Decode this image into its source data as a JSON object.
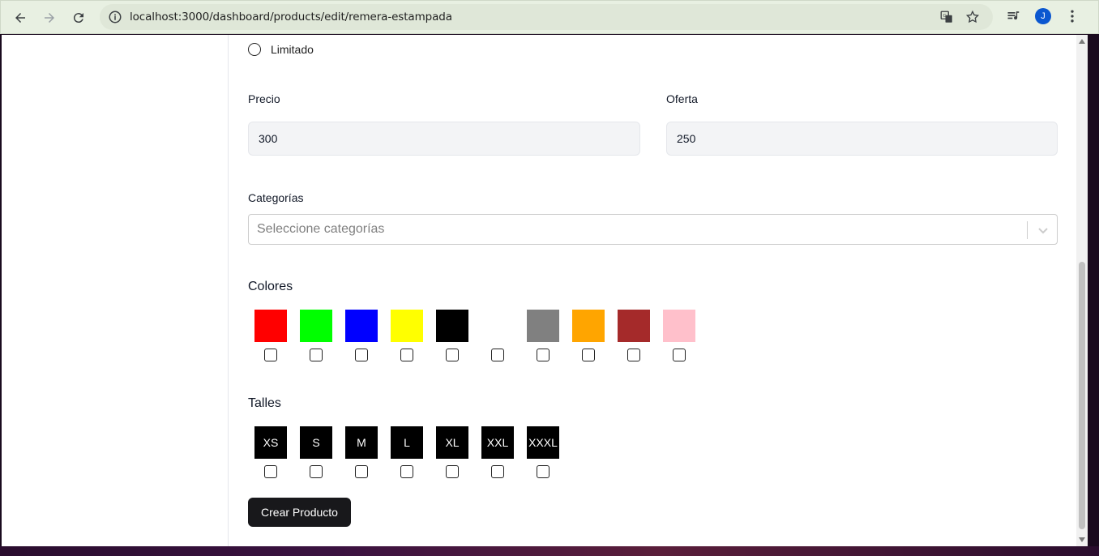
{
  "browser": {
    "url": "localhost:3000/dashboard/products/edit/remera-estampada",
    "profile_initial": "J",
    "accent": "#0b57d0"
  },
  "form": {
    "stock_option_label": "Limitado",
    "price_label": "Precio",
    "price_value": "300",
    "offer_label": "Oferta",
    "offer_value": "250",
    "categories_label": "Categorías",
    "categories_placeholder": "Seleccione categorías",
    "colors_label": "Colores",
    "colors": [
      "#ff0000",
      "#00ff00",
      "#0000ff",
      "#ffff00",
      "#000000",
      "#ffffff",
      "#808080",
      "#ffa500",
      "#a52a2a",
      "#ffc0cb"
    ],
    "sizes_label": "Talles",
    "sizes": [
      "XS",
      "S",
      "M",
      "L",
      "XL",
      "XXL",
      "XXXL"
    ],
    "submit_label": "Crear Producto"
  }
}
